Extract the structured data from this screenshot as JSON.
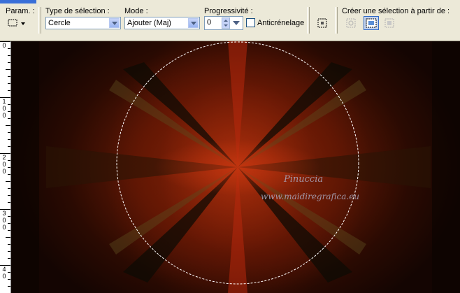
{
  "toolbar": {
    "param_label": "Param. :",
    "selection_type_label": "Type de sélection :",
    "selection_type_value": "Cercle",
    "mode_label": "Mode :",
    "mode_value": "Ajouter (Maj)",
    "feather_label": "Progressivité :",
    "feather_value": "0",
    "antialias_label": "Anticrénelage",
    "antialias_checked": false,
    "create_selection_label": "Créer une sélection à partir de :"
  },
  "ruler": {
    "numbers": [
      "0",
      "1",
      "0",
      "0",
      "2",
      "0",
      "0",
      "3",
      "0",
      "0",
      "4",
      "0"
    ]
  },
  "canvas": {
    "watermark_line1": "Pinuccia",
    "watermark_line2": "www.maidiregrafica.eu"
  },
  "colors": {
    "toolbar_bg": "#ece9d8",
    "selection_marquee": "#ffffff",
    "canvas_center": "#c0300f",
    "canvas_edge": "#140502"
  }
}
